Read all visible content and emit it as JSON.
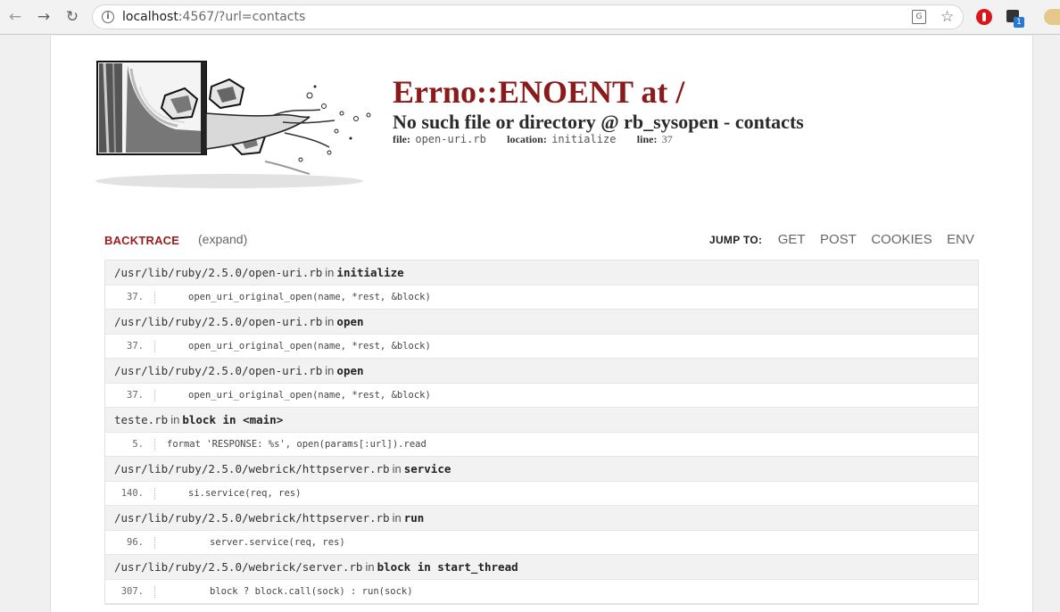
{
  "browser": {
    "url_host": "localhost",
    "url_rest": ":4567/?url=contacts",
    "icons": [
      "back-arrow-icon",
      "forward-arrow-icon",
      "reload-icon",
      "info-icon",
      "translate-icon",
      "bookmark-star-icon",
      "adblock-extension-icon",
      "extension-icon"
    ],
    "extension_badge": "1"
  },
  "error": {
    "title": "Errno::ENOENT at /",
    "message": "No such file or directory @ rb_sysopen - contacts",
    "file_label": "file:",
    "file_value": "open-uri.rb",
    "location_label": "location:",
    "location_value": "initialize",
    "line_label": "line:",
    "line_value": "37"
  },
  "backtrace": {
    "label": "BACKTRACE",
    "expand": "(expand)",
    "jump_label": "JUMP TO:",
    "jump_links": [
      "GET",
      "POST",
      "COOKIES",
      "ENV"
    ],
    "in_word": "in",
    "frames": [
      {
        "path": "/usr/lib/ruby/2.5.0/open-uri.rb",
        "method": "initialize",
        "line": "37.",
        "code": "open_uri_original_open(name, *rest, &block)",
        "indent": 1
      },
      {
        "path": "/usr/lib/ruby/2.5.0/open-uri.rb",
        "method": "open",
        "line": "37.",
        "code": "open_uri_original_open(name, *rest, &block)",
        "indent": 1
      },
      {
        "path": "/usr/lib/ruby/2.5.0/open-uri.rb",
        "method": "open",
        "line": "37.",
        "code": "open_uri_original_open(name, *rest, &block)",
        "indent": 1
      },
      {
        "path": "teste.rb",
        "method": "block in <main>",
        "line": "5.",
        "code": "format 'RESPONSE: %s', open(params[:url]).read",
        "indent": 0
      },
      {
        "path": "/usr/lib/ruby/2.5.0/webrick/httpserver.rb",
        "method": "service",
        "line": "140.",
        "code": "si.service(req, res)",
        "indent": 1
      },
      {
        "path": "/usr/lib/ruby/2.5.0/webrick/httpserver.rb",
        "method": "run",
        "line": "96.",
        "code": "server.service(req, res)",
        "indent": 2
      },
      {
        "path": "/usr/lib/ruby/2.5.0/webrick/server.rb",
        "method": "block in start_thread",
        "line": "307.",
        "code": "block ? block.call(sock) : run(sock)",
        "indent": 2
      }
    ]
  },
  "colors": {
    "title": "#8b1a1a",
    "backtrace_label": "#9b1b1b",
    "frame_header_bg": "#f2f2f2"
  }
}
